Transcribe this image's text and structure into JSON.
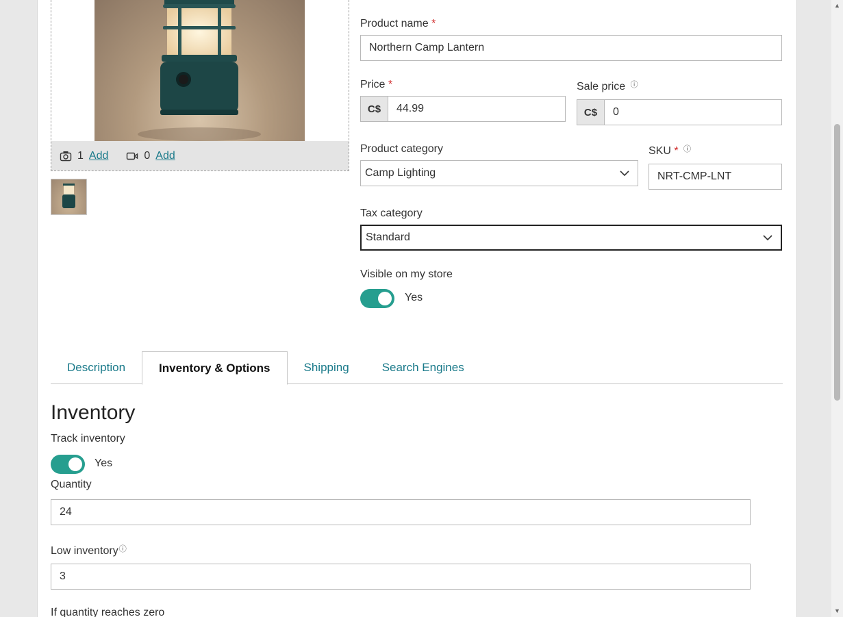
{
  "media": {
    "photo_count": "1",
    "photo_add": "Add",
    "video_count": "0",
    "video_add": "Add"
  },
  "form": {
    "product_name_label": "Product name",
    "product_name_value": "Northern Camp Lantern",
    "price_label": "Price",
    "price_prefix": "C$",
    "price_value": "44.99",
    "sale_price_label": "Sale price",
    "sale_price_prefix": "C$",
    "sale_price_value": "0",
    "category_label": "Product category",
    "category_value": "Camp Lighting",
    "sku_label": "SKU",
    "sku_value": "NRT-CMP-LNT",
    "tax_label": "Tax category",
    "tax_value": "Standard",
    "visible_label": "Visible on my store",
    "visible_value": "Yes",
    "required_mark": "*"
  },
  "tabs": [
    {
      "label": "Description"
    },
    {
      "label": "Inventory & Options"
    },
    {
      "label": "Shipping"
    },
    {
      "label": "Search Engines"
    }
  ],
  "inventory": {
    "heading": "Inventory",
    "track_label": "Track inventory",
    "track_value": "Yes",
    "quantity_label": "Quantity",
    "quantity_value": "24",
    "low_label": "Low inventory",
    "low_value": "3",
    "zero_label": "If quantity reaches zero"
  },
  "colors": {
    "accent": "#269e8f",
    "link": "#1a7a8a",
    "required": "#d02a2a"
  }
}
